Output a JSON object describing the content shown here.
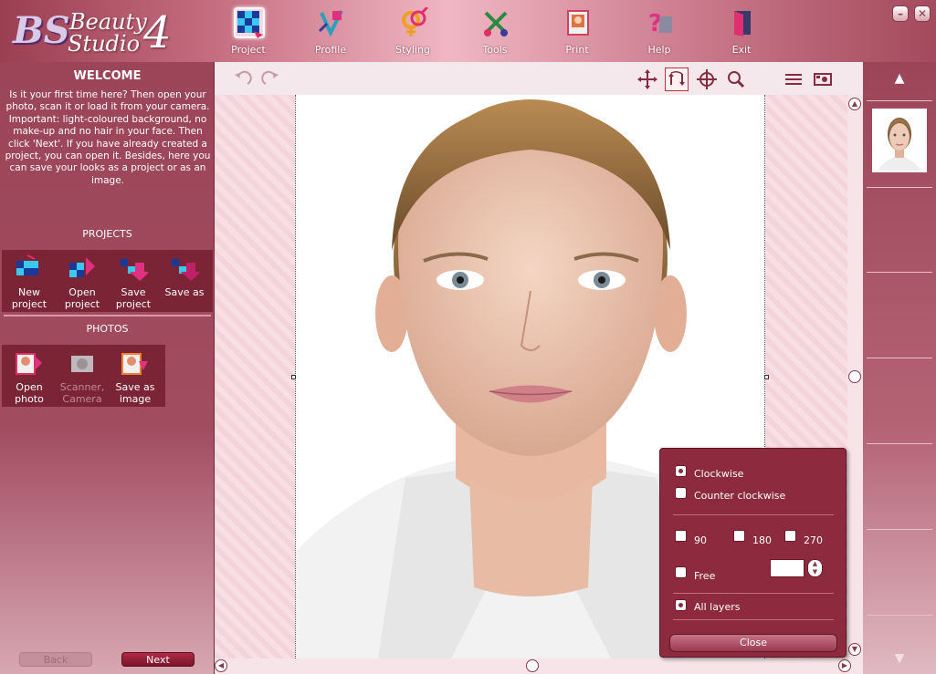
{
  "app": {
    "logo_mark": "BS",
    "logo_line1": "Beauty",
    "logo_line2": "Studio",
    "logo_version": "4"
  },
  "nav": [
    {
      "label": "Project",
      "icon": "project-icon",
      "active": true
    },
    {
      "label": "Profile",
      "icon": "profile-icon"
    },
    {
      "label": "Styling",
      "icon": "styling-icon"
    },
    {
      "label": "Tools",
      "icon": "tools-icon"
    },
    {
      "label": "Print",
      "icon": "print-icon"
    },
    {
      "label": "Help",
      "icon": "help-icon"
    },
    {
      "label": "Exit",
      "icon": "exit-icon"
    }
  ],
  "window": {
    "minimize": "–",
    "close": "✕"
  },
  "left": {
    "title": "WELCOME",
    "text": "Is it your first time here? Then open your photo, scan it or load it from your camera. Important: light-coloured background, no make-up and no hair in your face. Then click 'Next'. If you have already created a project, you can open it. Besides, here you can save your looks as a project or as an image.",
    "projects_header": "PROJECTS",
    "projects": [
      {
        "label": "New project",
        "icon": "new-project-icon"
      },
      {
        "label": "Open project",
        "icon": "open-project-icon"
      },
      {
        "label": "Save project",
        "icon": "save-project-icon"
      },
      {
        "label": "Save as",
        "icon": "save-as-icon"
      }
    ],
    "photos_header": "PHOTOS",
    "photos": [
      {
        "label": "Open photo",
        "icon": "open-photo-icon"
      },
      {
        "label": "Scanner, Camera",
        "icon": "scanner-camera-icon",
        "disabled": true
      },
      {
        "label": "Save as image",
        "icon": "save-image-icon"
      }
    ],
    "back_label": "Back",
    "next_label": "Next"
  },
  "rotate": {
    "clockwise": "Clockwise",
    "counter": "Counter clockwise",
    "d90": "90",
    "d180": "180",
    "d270": "270",
    "free": "Free",
    "free_value": "",
    "all_layers": "All layers",
    "close": "Close"
  },
  "colors": {
    "accent": "#8e2a3e",
    "panel": "#9c4558",
    "canvas": "#f4d4db"
  }
}
